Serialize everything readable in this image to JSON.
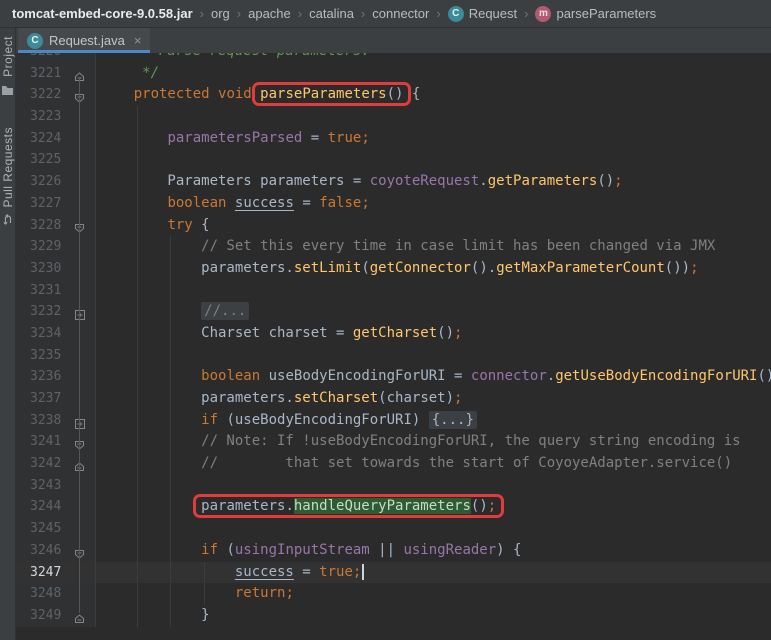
{
  "colors": {
    "annotation_red": "#e13c3c",
    "search_hit_green": "#2d5b36",
    "tab_underline_blue": "#4a88c7",
    "editor_bg": "#2b2b2b",
    "chrome_bg": "#3c3f41"
  },
  "icons": {
    "class_letter": "C",
    "method_letter": "m"
  },
  "breadcrumb": {
    "separator": "›",
    "items": [
      {
        "label": "tomcat-embed-core-9.0.58.jar",
        "bold": true
      },
      {
        "label": "org"
      },
      {
        "label": "apache"
      },
      {
        "label": "catalina"
      },
      {
        "label": "connector"
      },
      {
        "label": "Request",
        "icon": "class"
      },
      {
        "label": "parseParameters",
        "icon": "method"
      }
    ]
  },
  "tab": {
    "label": "Request.java",
    "close_label": "×",
    "icon": "class"
  },
  "stripe": {
    "items": [
      {
        "label": "Project",
        "icon": "folder"
      },
      {
        "label": "Pull Requests",
        "icon": "pull-request"
      }
    ]
  },
  "editor": {
    "indent_guides": [
      {
        "col": 4,
        "from_row": 3,
        "to_row": 27
      },
      {
        "col": 8,
        "from_row": 9,
        "to_row": 27
      },
      {
        "col": 12,
        "from_row": 24,
        "to_row": 26
      }
    ],
    "lines": [
      {
        "num": "3220",
        "fold": "none",
        "tokens": [
          [
            "doc",
            "     * Parse request parameters."
          ]
        ]
      },
      {
        "num": "3221",
        "fold": "end",
        "tokens": [
          [
            "doc",
            "     */"
          ]
        ]
      },
      {
        "num": "3222",
        "fold": "start",
        "redbox": [
          5,
          6
        ],
        "tokens": [
          [
            "pln",
            "    "
          ],
          [
            "kw",
            "protected"
          ],
          [
            "pln",
            " "
          ],
          [
            "kw",
            "void"
          ],
          [
            "pln",
            " "
          ],
          [
            "mth",
            "parseParameters"
          ],
          [
            "pln",
            "()"
          ],
          [
            "pln",
            " {"
          ]
        ]
      },
      {
        "num": "3223",
        "fold": "none",
        "tokens": []
      },
      {
        "num": "3224",
        "fold": "none",
        "tokens": [
          [
            "pln",
            "        "
          ],
          [
            "fld",
            "parametersParsed"
          ],
          [
            "pln",
            " = "
          ],
          [
            "kw",
            "true"
          ],
          [
            "semi",
            ";"
          ]
        ]
      },
      {
        "num": "3225",
        "fold": "none",
        "tokens": []
      },
      {
        "num": "3226",
        "fold": "none",
        "tokens": [
          [
            "pln",
            "        Parameters parameters = "
          ],
          [
            "fld",
            "coyoteRequest"
          ],
          [
            "pln",
            "."
          ],
          [
            "mth",
            "getParameters"
          ],
          [
            "pln",
            "()"
          ],
          [
            "semi",
            ";"
          ]
        ]
      },
      {
        "num": "3227",
        "fold": "none",
        "tokens": [
          [
            "pln",
            "        "
          ],
          [
            "kw",
            "boolean"
          ],
          [
            "pln",
            " "
          ],
          [
            "und",
            "success"
          ],
          [
            "pln",
            " = "
          ],
          [
            "kw",
            "false"
          ],
          [
            "semi",
            ";"
          ]
        ]
      },
      {
        "num": "3228",
        "fold": "start",
        "tokens": [
          [
            "pln",
            "        "
          ],
          [
            "kw",
            "try"
          ],
          [
            "pln",
            " {"
          ]
        ]
      },
      {
        "num": "3229",
        "fold": "none",
        "tokens": [
          [
            "com",
            "            // Set this every time in case limit has been changed via JMX"
          ]
        ]
      },
      {
        "num": "3230",
        "fold": "none",
        "tokens": [
          [
            "pln",
            "            parameters."
          ],
          [
            "mth",
            "setLimit"
          ],
          [
            "pln",
            "("
          ],
          [
            "mth",
            "getConnector"
          ],
          [
            "pln",
            "()."
          ],
          [
            "mth",
            "getMaxParameterCount"
          ],
          [
            "pln",
            "())"
          ],
          [
            "semi",
            ";"
          ]
        ]
      },
      {
        "num": "3231",
        "fold": "none",
        "tokens": []
      },
      {
        "num": "3232",
        "fold": "collapsed",
        "tokens": [
          [
            "pln",
            "            "
          ],
          [
            "chip",
            "//..."
          ]
        ]
      },
      {
        "num": "3234",
        "fold": "none",
        "tokens": [
          [
            "pln",
            "            Charset charset = "
          ],
          [
            "mth",
            "getCharset"
          ],
          [
            "pln",
            "()"
          ],
          [
            "semi",
            ";"
          ]
        ]
      },
      {
        "num": "3235",
        "fold": "none",
        "tokens": []
      },
      {
        "num": "3236",
        "fold": "none",
        "tokens": [
          [
            "pln",
            "            "
          ],
          [
            "kw",
            "boolean"
          ],
          [
            "pln",
            " useBodyEncodingForURI = "
          ],
          [
            "fld",
            "connector"
          ],
          [
            "pln",
            "."
          ],
          [
            "mth",
            "getUseBodyEncodingForURI"
          ],
          [
            "pln",
            "()"
          ],
          [
            "semi",
            ";"
          ]
        ]
      },
      {
        "num": "3237",
        "fold": "none",
        "tokens": [
          [
            "pln",
            "            parameters."
          ],
          [
            "mth",
            "setCharset"
          ],
          [
            "pln",
            "(charset)"
          ],
          [
            "semi",
            ";"
          ]
        ]
      },
      {
        "num": "3238",
        "fold": "collapsed",
        "tokens": [
          [
            "pln",
            "            "
          ],
          [
            "kw",
            "if"
          ],
          [
            "pln",
            " (useBodyEncodingForURI) "
          ],
          [
            "chippln",
            "{...}"
          ]
        ]
      },
      {
        "num": "3241",
        "fold": "start",
        "tokens": [
          [
            "com",
            "            // Note: If !useBodyEncodingForURI, the query string encoding is"
          ]
        ]
      },
      {
        "num": "3242",
        "fold": "end",
        "tokens": [
          [
            "com",
            "            //        that set towards the start of CoyoyeAdapter.service()"
          ]
        ]
      },
      {
        "num": "3243",
        "fold": "none",
        "tokens": []
      },
      {
        "num": "3244",
        "fold": "none",
        "redbox": [
          1,
          4
        ],
        "tokens": [
          [
            "pln",
            "            "
          ],
          [
            "pln",
            "parameters."
          ],
          [
            "hit",
            "handleQueryParameters"
          ],
          [
            "pln",
            "()"
          ],
          [
            "semi",
            ";"
          ]
        ]
      },
      {
        "num": "3245",
        "fold": "none",
        "tokens": []
      },
      {
        "num": "3246",
        "fold": "start",
        "tokens": [
          [
            "pln",
            "            "
          ],
          [
            "kw",
            "if"
          ],
          [
            "pln",
            " ("
          ],
          [
            "fld",
            "usingInputStream"
          ],
          [
            "pln",
            " || "
          ],
          [
            "fld",
            "usingReader"
          ],
          [
            "pln",
            ") {"
          ]
        ]
      },
      {
        "num": "3247",
        "fold": "none",
        "current": true,
        "tokens": [
          [
            "pln",
            "                "
          ],
          [
            "und",
            "success"
          ],
          [
            "pln",
            " = "
          ],
          [
            "kw",
            "true"
          ],
          [
            "semi",
            ";"
          ],
          [
            "caret",
            ""
          ]
        ]
      },
      {
        "num": "3248",
        "fold": "none",
        "tokens": [
          [
            "pln",
            "                "
          ],
          [
            "kw",
            "return"
          ],
          [
            "semi",
            ";"
          ]
        ]
      },
      {
        "num": "3249",
        "fold": "end",
        "tokens": [
          [
            "pln",
            "            }"
          ]
        ]
      }
    ]
  }
}
